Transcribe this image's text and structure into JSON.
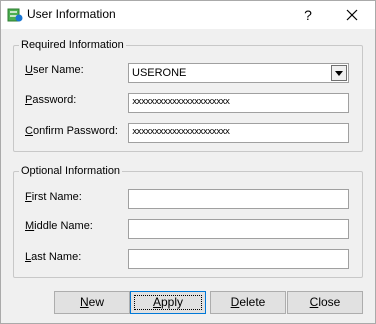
{
  "window": {
    "title": "User Information",
    "help_glyph": "?"
  },
  "required": {
    "legend": "Required Information",
    "user_name": {
      "label_first": "U",
      "label_rest": "ser Name:",
      "value": "USERONE"
    },
    "password": {
      "label_first": "P",
      "label_rest": "assword:",
      "value": "xxxxxxxxxxxxxxxxxxxxxx"
    },
    "confirm_password": {
      "label_first": "C",
      "label_rest": "onfirm Password:",
      "value": "xxxxxxxxxxxxxxxxxxxxxx"
    }
  },
  "optional": {
    "legend": "Optional Information",
    "first_name": {
      "label_first": "F",
      "label_rest": "irst Name:",
      "value": ""
    },
    "middle_name": {
      "label_first": "M",
      "label_rest": "iddle Name:",
      "value": ""
    },
    "last_name": {
      "label_first": "L",
      "label_rest": "ast Name:",
      "value": ""
    }
  },
  "buttons": {
    "new": {
      "first": "N",
      "rest": "ew"
    },
    "apply": {
      "first": "A",
      "rest": "pply"
    },
    "delete": {
      "first": "D",
      "rest": "elete"
    },
    "close": {
      "first": "C",
      "rest": "lose"
    }
  },
  "icons": {
    "app": "user-info-app-icon",
    "close": "close-icon",
    "dropdown": "chevron-down-icon"
  }
}
